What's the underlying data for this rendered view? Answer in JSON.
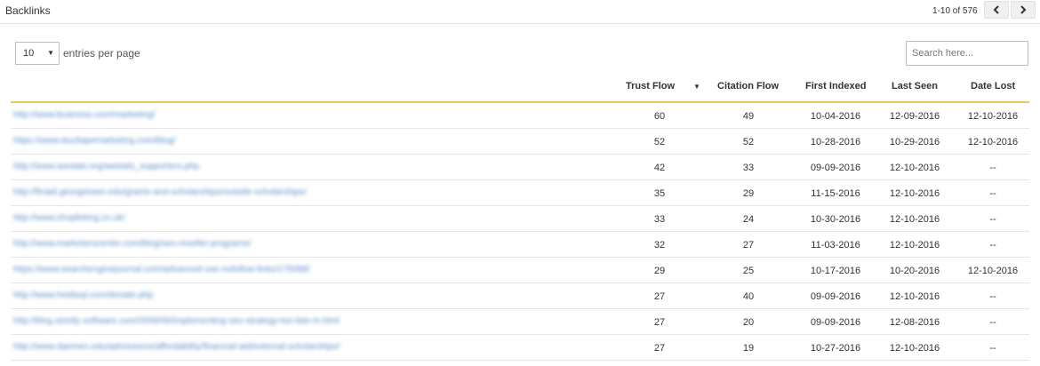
{
  "header": {
    "title": "Backlinks",
    "pager": {
      "count": "1-10 of 576",
      "prev_icon": "chevron-left-icon",
      "next_icon": "chevron-right-icon"
    }
  },
  "controls": {
    "entries_value": "10",
    "entries_label": "entries per page",
    "search_placeholder": "Search here..."
  },
  "columns": {
    "trust_flow": "Trust Flow",
    "citation_flow": "Citation Flow",
    "first_indexed": "First Indexed",
    "last_seen": "Last Seen",
    "date_lost": "Date Lost"
  },
  "sort": {
    "column": "Trust Flow",
    "direction": "descending",
    "icon": "caret-down-icon"
  },
  "colors": {
    "accent_rule": "#f0c55e",
    "link": "#5b8fc7"
  },
  "rows": [
    {
      "url": "http://www.business.com/marketing/",
      "trust_flow": "60",
      "citation_flow": "49",
      "first_indexed": "10-04-2016",
      "last_seen": "12-09-2016",
      "date_lost": "12-10-2016"
    },
    {
      "url": "https://www.ducttapemarketing.com/blog/",
      "trust_flow": "52",
      "citation_flow": "52",
      "first_indexed": "10-28-2016",
      "last_seen": "10-29-2016",
      "date_lost": "12-10-2016"
    },
    {
      "url": "http://www.awstats.org/awstats_supporters.php",
      "trust_flow": "42",
      "citation_flow": "33",
      "first_indexed": "09-09-2016",
      "last_seen": "12-10-2016",
      "date_lost": "--"
    },
    {
      "url": "http://finaid.georgetown.edu/grants-and-scholarships/outside-scholarships/",
      "trust_flow": "35",
      "citation_flow": "29",
      "first_indexed": "11-15-2016",
      "last_seen": "12-10-2016",
      "date_lost": "--"
    },
    {
      "url": "http://www.shoplisting.co.uk/",
      "trust_flow": "33",
      "citation_flow": "24",
      "first_indexed": "10-30-2016",
      "last_seen": "12-10-2016",
      "date_lost": "--"
    },
    {
      "url": "http://www.marketerscenter.com/blog/seo-reseller-programs/",
      "trust_flow": "32",
      "citation_flow": "27",
      "first_indexed": "11-03-2016",
      "last_seen": "12-10-2016",
      "date_lost": "--"
    },
    {
      "url": "https://www.searchenginejournal.com/advanced-use-nofollow-links/175088/",
      "trust_flow": "29",
      "citation_flow": "25",
      "first_indexed": "10-17-2016",
      "last_seen": "10-20-2016",
      "date_lost": "12-10-2016"
    },
    {
      "url": "http://www.heidisql.com/donate.php",
      "trust_flow": "27",
      "citation_flow": "40",
      "first_indexed": "09-09-2016",
      "last_seen": "12-10-2016",
      "date_lost": "--"
    },
    {
      "url": "http://blog.strictly-software.com/2009/06/implementing-seo-strategy-too-late-in.html",
      "trust_flow": "27",
      "citation_flow": "20",
      "first_indexed": "09-09-2016",
      "last_seen": "12-08-2016",
      "date_lost": "--"
    },
    {
      "url": "http://www.daemen.edu/admissions/affordability/financial-aid/external-scholarships/",
      "trust_flow": "27",
      "citation_flow": "19",
      "first_indexed": "10-27-2016",
      "last_seen": "12-10-2016",
      "date_lost": "--"
    }
  ]
}
